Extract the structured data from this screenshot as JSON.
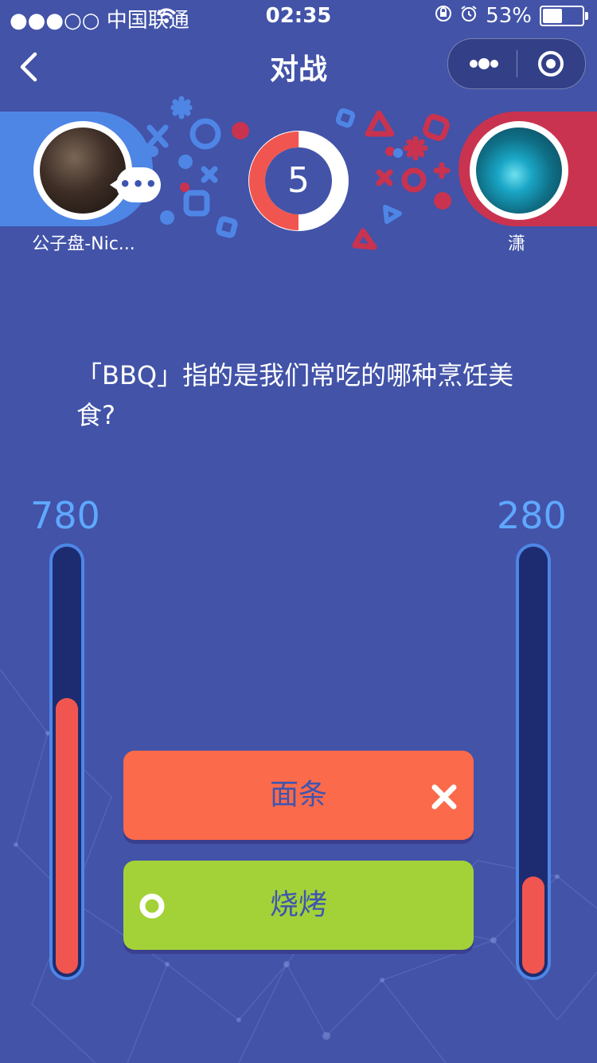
{
  "status_bar": {
    "carrier": "●●●○○ 中国联通",
    "time": "02:35",
    "battery": "53%",
    "battery_level": 0.53
  },
  "nav": {
    "title": "对战",
    "back_icon": "chevron-left-icon",
    "more_icon": "more-dots-icon",
    "close_icon": "target-circle-icon"
  },
  "players": {
    "left": {
      "name": "公子盘-Nic...",
      "score": "780",
      "score_level": 0.65
    },
    "right": {
      "name": "潇",
      "score": "280",
      "score_level": 0.23
    }
  },
  "timer": {
    "value": "5",
    "progress": 0.5
  },
  "question": {
    "text": "「BBQ」指的是我们常吃的哪种烹饪美食?"
  },
  "options": [
    {
      "label": "面条",
      "state": "wrong"
    },
    {
      "label": "烧烤",
      "state": "correct"
    }
  ],
  "colors": {
    "background": "#4253a8",
    "left_accent": "#4e86e6",
    "right_accent": "#c9334f",
    "wrong": "#fb6a4a",
    "correct": "#a3d238",
    "gauge_fill": "#f0564f",
    "score_text": "#5fa8ff"
  }
}
